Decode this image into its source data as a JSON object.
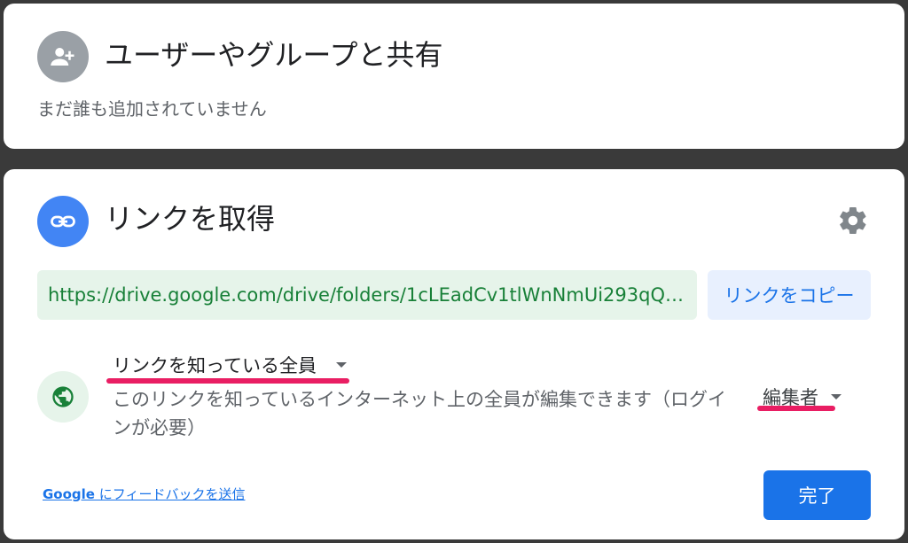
{
  "share_section": {
    "title": "ユーザーやグループと共有",
    "empty_text": "まだ誰も追加されていません",
    "icon": "person-add-icon"
  },
  "link_section": {
    "title": "リンクを取得",
    "icon": "link-icon",
    "settings_icon": "gear-icon",
    "url": "https://drive.google.com/drive/folders/1cLEadCv1tlWnNmUi293qQaG…",
    "copy_label": "リンクをコピー",
    "access": {
      "icon": "globe-icon",
      "label": "リンクを知っている全員",
      "description": "このリンクを知っているインターネット上の全員が編集できます（ログインが必要）",
      "role": "編集者"
    },
    "feedback": {
      "brand": "Google",
      "text": " にフィードバックを送信"
    },
    "done_label": "完了"
  },
  "colors": {
    "accent": "#1a73e8",
    "link_green": "#188038",
    "highlight": "#e91e63"
  }
}
